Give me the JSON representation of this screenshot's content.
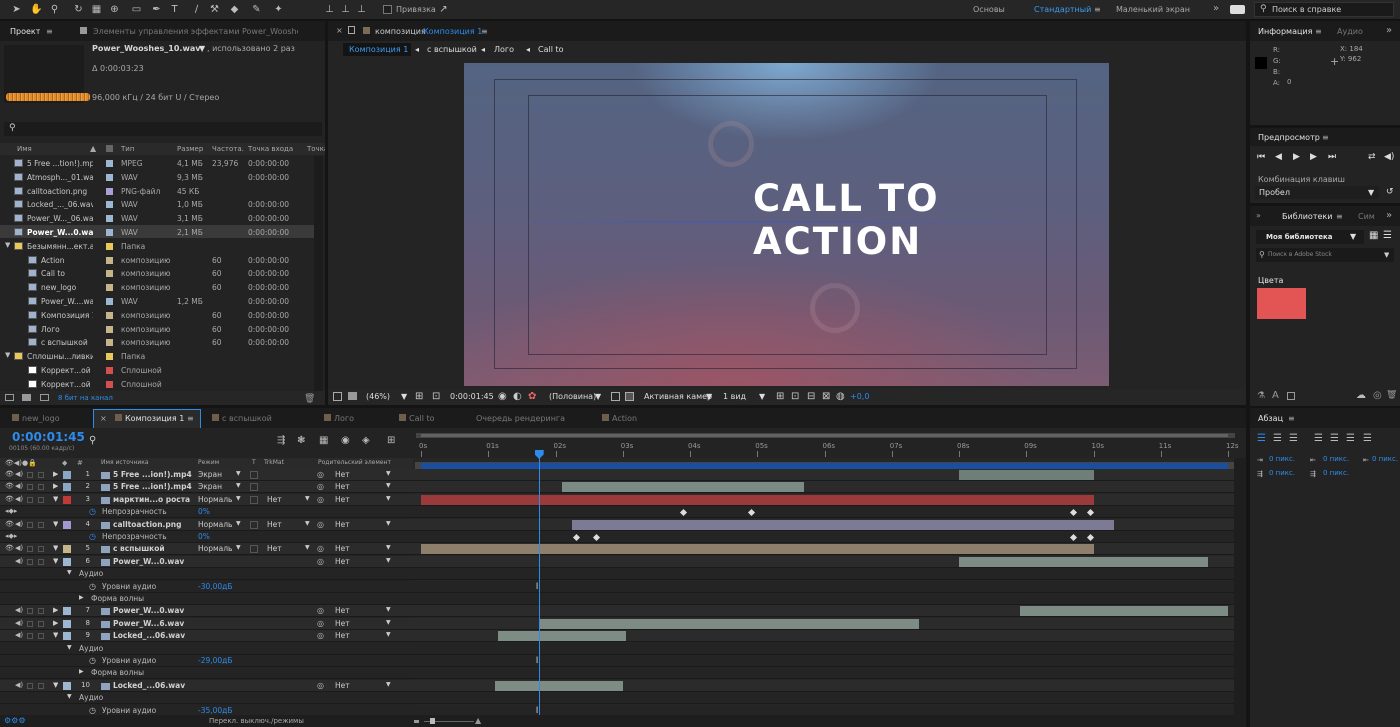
{
  "toolbar": {
    "snap_label": "Привязка",
    "workspaces": [
      "Основы",
      "Стандартный",
      "Маленький экран"
    ],
    "active_workspace": "Стандартный",
    "search_placeholder": "Поиск в справке"
  },
  "project": {
    "tab": "Проект",
    "effects_tab": "Элементы управления эффектами Power_Wooshes_1",
    "selected_name": "Power_Wooshes_10.wav",
    "used": ", использовано 2 раз",
    "duration": "Δ 0:00:03:23",
    "audio_info": "96,000 кГц / 24 бит U / Стерео",
    "search_placeholder": "",
    "columns": [
      "Имя",
      "Тип",
      "Размер",
      "Частота...",
      "Точка входа",
      "Точка"
    ],
    "items": [
      {
        "name": "5 Free ...tion!).mp4",
        "type": "MPEG",
        "size": "4,1 МБ",
        "fps": "23,976",
        "in": "0:00:00:00",
        "color": "#9db6d1",
        "indent": 0,
        "icon": "video-file"
      },
      {
        "name": "Atmosph..._01.wav",
        "type": "WAV",
        "size": "9,3 МБ",
        "fps": "",
        "in": "0:00:00:00",
        "color": "#9db6d1",
        "indent": 0,
        "icon": "audio-file"
      },
      {
        "name": "calltoaction.png",
        "type": "PNG-файл",
        "size": "45 КБ",
        "fps": "",
        "in": "",
        "color": "#a9a0d8",
        "indent": 0,
        "icon": "image-file"
      },
      {
        "name": "Locked_..._06.wav",
        "type": "WAV",
        "size": "1,0 МБ",
        "fps": "",
        "in": "0:00:00:00",
        "color": "#9db6d1",
        "indent": 0,
        "icon": "audio-file"
      },
      {
        "name": "Power_W..._06.wav",
        "type": "WAV",
        "size": "3,1 МБ",
        "fps": "",
        "in": "0:00:00:00",
        "color": "#9db6d1",
        "indent": 0,
        "icon": "audio-file"
      },
      {
        "name": "Power_W...0.wav",
        "type": "WAV",
        "size": "2,1 МБ",
        "fps": "",
        "in": "0:00:00:00",
        "color": "#9db6d1",
        "indent": 0,
        "icon": "audio-file",
        "selected": true
      },
      {
        "name": "Безымянн...ект.аер",
        "type": "Папка",
        "size": "",
        "fps": "",
        "in": "",
        "color": "#e8c85a",
        "indent": 0,
        "icon": "folder"
      },
      {
        "name": "Action",
        "type": "композицию",
        "size": "",
        "fps": "60",
        "in": "0:00:00:00",
        "color": "#c6b48a",
        "indent": 1,
        "icon": "composition"
      },
      {
        "name": "Call to",
        "type": "композицию",
        "size": "",
        "fps": "60",
        "in": "0:00:00:00",
        "color": "#c6b48a",
        "indent": 1,
        "icon": "composition"
      },
      {
        "name": "new_logo",
        "type": "композицию",
        "size": "",
        "fps": "60",
        "in": "0:00:00:00",
        "color": "#c6b48a",
        "indent": 1,
        "icon": "composition"
      },
      {
        "name": "Power_W....wav",
        "type": "WAV",
        "size": "1,2 МБ",
        "fps": "",
        "in": "0:00:00:00",
        "color": "#9db6d1",
        "indent": 1,
        "icon": "audio-file"
      },
      {
        "name": "Композиция 1",
        "type": "композицию",
        "size": "",
        "fps": "60",
        "in": "0:00:00:00",
        "color": "#c6b48a",
        "indent": 1,
        "icon": "composition"
      },
      {
        "name": "Лого",
        "type": "композицию",
        "size": "",
        "fps": "60",
        "in": "0:00:00:00",
        "color": "#c6b48a",
        "indent": 1,
        "icon": "composition"
      },
      {
        "name": "с вспышкой",
        "type": "композицию",
        "size": "",
        "fps": "60",
        "in": "0:00:00:00",
        "color": "#c6b48a",
        "indent": 1,
        "icon": "composition"
      },
      {
        "name": "Сплошны...ливки",
        "type": "Папка",
        "size": "",
        "fps": "",
        "in": "",
        "color": "#e8c85a",
        "indent": 0,
        "icon": "folder"
      },
      {
        "name": "Коррект...ой 1",
        "type": "Сплошной",
        "size": "",
        "fps": "",
        "in": "",
        "color": "#d45050",
        "indent": 1,
        "icon": "solid"
      },
      {
        "name": "Коррект...ой 2",
        "type": "Сплошной",
        "size": "",
        "fps": "",
        "in": "",
        "color": "#d45050",
        "indent": 1,
        "icon": "solid"
      }
    ],
    "bit_depth": "8 бит на канал"
  },
  "comp": {
    "tab_prefix": "композиция",
    "tab_name": "Композиция 1",
    "breadcrumbs": [
      "Композиция 1",
      "с вспышкой",
      "Лого",
      "Call to"
    ],
    "title_text_line1": "CALL TO",
    "title_text_line2": "ACTION",
    "zoom": "(46%)",
    "timecode": "0:00:01:45",
    "resolution": "(Половина)",
    "camera": "Активная камер",
    "views": "1 вид",
    "exposure": "+0,0"
  },
  "info": {
    "tab": "Информация",
    "audio_tab": "Аудио",
    "labels": [
      "R:",
      "G:",
      "B:",
      "A:"
    ],
    "a_value": "0",
    "x": "X: 184",
    "y": "Y: 962"
  },
  "preview": {
    "tab": "Предпросмотр",
    "shortcut_label": "Комбинация клавиш",
    "shortcut_value": "Пробел"
  },
  "libraries": {
    "tab": "Библиотеки",
    "tab2": "Сим",
    "library": "Моя библиотека",
    "search_placeholder": "Поиск в Adobe Stock",
    "colors_label": "Цвета",
    "swatch": "#e35454"
  },
  "paragraph": {
    "tab": "Абзац",
    "fields": [
      "0 пикс.",
      "0 пикс.",
      "0 пикс.",
      "0 пикс.",
      "0 пикс."
    ]
  },
  "timeline": {
    "tabs": [
      "new_logo",
      "Композиция 1",
      "с вспышкой",
      "Лого",
      "Call to",
      "Очередь рендеринга",
      "Action"
    ],
    "active_tab": "Композиция 1",
    "timecode": "0:00:01:45",
    "frames": "00105 (60.00 кадр/с)",
    "columns": [
      "Имя источника",
      "Режим",
      "T",
      "TrkMat",
      "Родительский элемент"
    ],
    "ruler": [
      "0s",
      "01s",
      "02s",
      "03s",
      "04s",
      "05s",
      "06s",
      "07s",
      "08s",
      "09s",
      "10s",
      "11s",
      "12s"
    ],
    "current_time": 1.75,
    "duration": 12,
    "bottom_label": "Перекл. выключ./режимы",
    "layers": [
      {
        "kind": "layer",
        "num": "1",
        "name": "5 Free ...ion!).mp4",
        "mode": "Экран",
        "trk": "",
        "parent": "Нет",
        "color": "#8aa7c4",
        "start": 8,
        "end": 10,
        "bar": "#6f7f78"
      },
      {
        "kind": "layer",
        "num": "2",
        "name": "5 Free ...ion!).mp4",
        "mode": "Экран",
        "trk": "",
        "parent": "Нет",
        "color": "#8aa7c4",
        "start": 2.1,
        "end": 5.7,
        "bar": "#7b8a84"
      },
      {
        "kind": "layer",
        "num": "3",
        "name": "марктин...о роста",
        "mode": "Нормаль",
        "trk": "Нет",
        "parent": "Нет",
        "color": "#c03a3a",
        "start": 0,
        "end": 10,
        "bar": "#9b3a3a"
      },
      {
        "kind": "prop",
        "name": "Непрозрачность",
        "value": "0%",
        "keys": [
          3.9,
          4.9,
          9.7,
          9.95
        ]
      },
      {
        "kind": "layer",
        "num": "4",
        "name": "calltoaction.png",
        "mode": "Нормаль",
        "trk": "Нет",
        "parent": "Нет",
        "color": "#a09ad0",
        "start": 2.25,
        "end": 10.3,
        "bar": "#7c7a95"
      },
      {
        "kind": "prop",
        "name": "Непрозрачность",
        "value": "0%",
        "keys": [
          2.3,
          2.6,
          9.7,
          9.95
        ]
      },
      {
        "kind": "layer",
        "num": "5",
        "name": "с вспышкой",
        "mode": "Нормаль",
        "trk": "Нет",
        "parent": "Нет",
        "color": "#c6b48a",
        "start": 0,
        "end": 10,
        "bar": "#8e7e6c"
      },
      {
        "kind": "layer",
        "num": "6",
        "name": "Power_W...0.wav",
        "mode": "",
        "trk": "",
        "parent": "Нет",
        "color": "#9db6d1",
        "start": 8,
        "end": 11.7,
        "bar": "#7e8c86"
      },
      {
        "kind": "group",
        "name": "Аудио"
      },
      {
        "kind": "sub",
        "name": "Уровни аудио",
        "value": "-30,00дБ"
      },
      {
        "kind": "group2",
        "name": "Форма волны"
      },
      {
        "kind": "layer",
        "num": "7",
        "name": "Power_W...0.wav",
        "mode": "",
        "trk": "",
        "parent": "Нет",
        "color": "#9db6d1",
        "start": 8.9,
        "end": 12,
        "bar": "#7e8c86"
      },
      {
        "kind": "layer",
        "num": "8",
        "name": "Power_W...6.wav",
        "mode": "",
        "trk": "",
        "parent": "Нет",
        "color": "#9db6d1",
        "start": 1.75,
        "end": 7.4,
        "bar": "#7e8c86"
      },
      {
        "kind": "layer",
        "num": "9",
        "name": "Locked_...06.wav",
        "mode": "",
        "trk": "",
        "parent": "Нет",
        "color": "#9db6d1",
        "start": 1.15,
        "end": 3.05,
        "bar": "#7e8c86"
      },
      {
        "kind": "group",
        "name": "Аудио"
      },
      {
        "kind": "sub",
        "name": "Уровни аудио",
        "value": "-29,00дБ"
      },
      {
        "kind": "group2",
        "name": "Форма волны"
      },
      {
        "kind": "layer",
        "num": "10",
        "name": "Locked_...06.wav",
        "mode": "",
        "trk": "",
        "parent": "Нет",
        "color": "#9db6d1",
        "start": 1.1,
        "end": 3,
        "bar": "#7e8c86"
      },
      {
        "kind": "group",
        "name": "Аудио"
      },
      {
        "kind": "sub",
        "name": "Уровни аудио",
        "value": "-35,00дБ"
      }
    ]
  }
}
